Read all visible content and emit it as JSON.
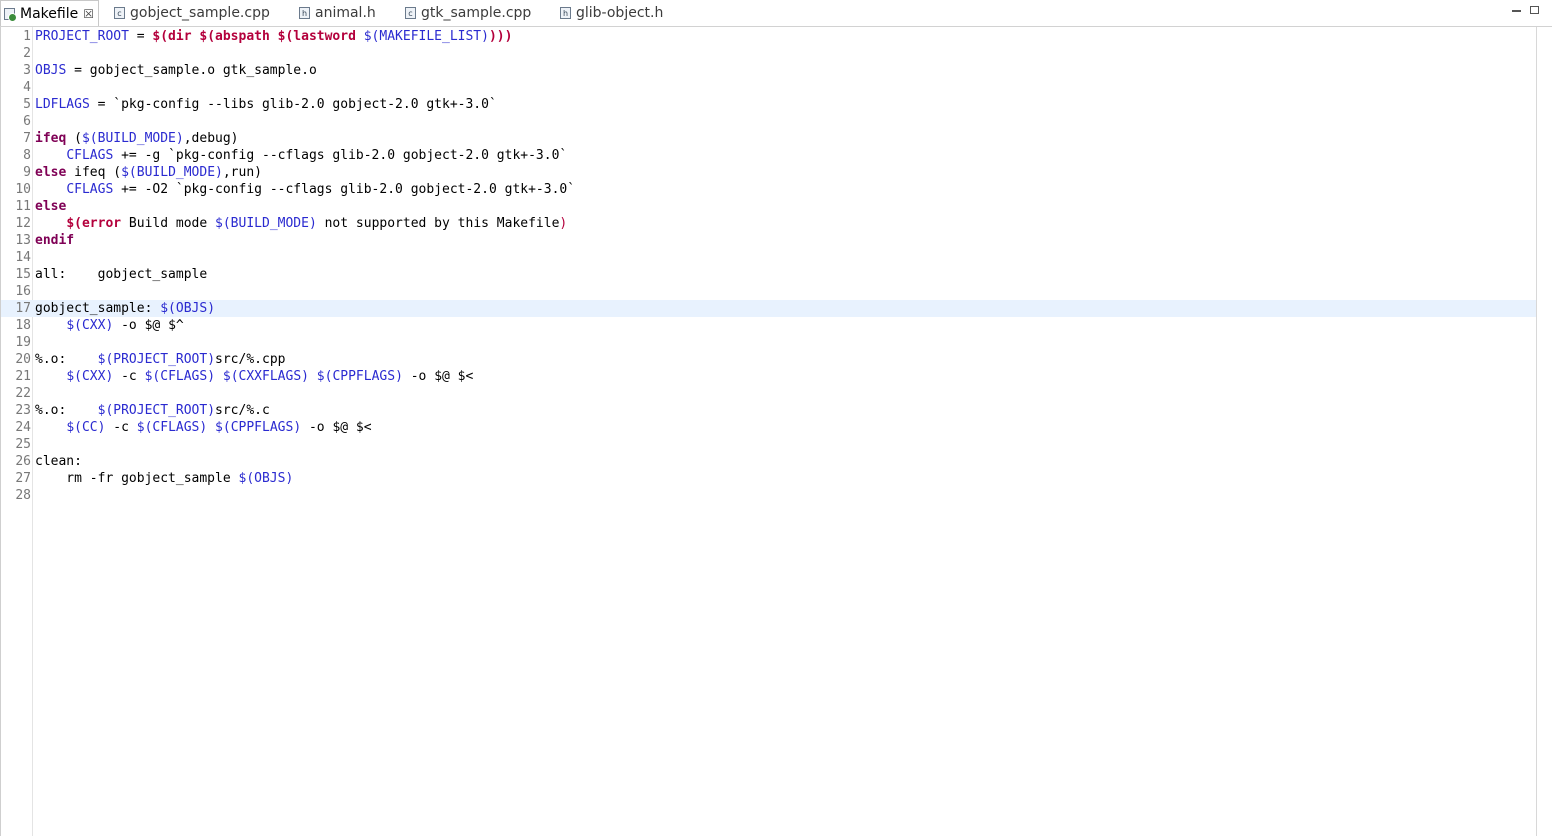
{
  "tabs": [
    {
      "label": "Makefile",
      "icon": "makefile-icon",
      "active": true
    },
    {
      "label": "gobject_sample.cpp",
      "icon": "cpp-file-icon"
    },
    {
      "label": "animal.h",
      "icon": "header-file-icon"
    },
    {
      "label": "gtk_sample.cpp",
      "icon": "cpp-file-icon"
    },
    {
      "label": "glib-object.h",
      "icon": "header-file-icon"
    }
  ],
  "close_glyph": "☒",
  "colors": {
    "variable": "#2a2ad0",
    "keyword": "#7f0055",
    "function": "#b4003c",
    "current_line": "#e8f2fe"
  },
  "current_line": 17,
  "lines": [
    {
      "n": "1",
      "segs": [
        [
          "v",
          "PROJECT_ROOT"
        ],
        [
          "p",
          " = "
        ],
        [
          "f",
          "$(dir $(abspath $(lastword "
        ],
        [
          "v",
          "$(MAKEFILE_LIST)"
        ],
        [
          "f",
          ")))"
        ]
      ]
    },
    {
      "n": "2",
      "segs": []
    },
    {
      "n": "3",
      "segs": [
        [
          "v",
          "OBJS"
        ],
        [
          "p",
          " = gobject_sample.o gtk_sample.o"
        ]
      ]
    },
    {
      "n": "4",
      "segs": []
    },
    {
      "n": "5",
      "segs": [
        [
          "v",
          "LDFLAGS"
        ],
        [
          "p",
          " = `pkg-config --libs glib-2.0 gobject-2.0 gtk+-3.0`"
        ]
      ]
    },
    {
      "n": "6",
      "segs": []
    },
    {
      "n": "7",
      "segs": [
        [
          "k",
          "ifeq"
        ],
        [
          "p",
          " ("
        ],
        [
          "v",
          "$(BUILD_MODE)"
        ],
        [
          "p",
          ",debug)"
        ]
      ]
    },
    {
      "n": "8",
      "segs": [
        [
          "p",
          "    "
        ],
        [
          "v",
          "CFLAGS"
        ],
        [
          "p",
          " += -g `pkg-config --cflags glib-2.0 gobject-2.0 gtk+-3.0`"
        ]
      ]
    },
    {
      "n": "9",
      "segs": [
        [
          "k",
          "else"
        ],
        [
          "p",
          " ifeq ("
        ],
        [
          "v",
          "$(BUILD_MODE)"
        ],
        [
          "p",
          ",run)"
        ]
      ]
    },
    {
      "n": "10",
      "segs": [
        [
          "p",
          "    "
        ],
        [
          "v",
          "CFLAGS"
        ],
        [
          "p",
          " += -O2 `pkg-config --cflags glib-2.0 gobject-2.0 gtk+-3.0`"
        ]
      ]
    },
    {
      "n": "11",
      "segs": [
        [
          "k",
          "else"
        ]
      ]
    },
    {
      "n": "12",
      "segs": [
        [
          "p",
          "    "
        ],
        [
          "f",
          "$(error"
        ],
        [
          "p",
          " Build mode "
        ],
        [
          "v",
          "$(BUILD_MODE)"
        ],
        [
          "p",
          " not supported by this Makefile"
        ],
        [
          "r",
          ")"
        ]
      ]
    },
    {
      "n": "13",
      "segs": [
        [
          "k",
          "endif"
        ]
      ]
    },
    {
      "n": "14",
      "segs": []
    },
    {
      "n": "15",
      "segs": [
        [
          "p",
          "all:    gobject_sample"
        ]
      ]
    },
    {
      "n": "16",
      "segs": []
    },
    {
      "n": "17",
      "segs": [
        [
          "p",
          "gobject_sample: "
        ],
        [
          "v",
          "$(OBJS)"
        ]
      ]
    },
    {
      "n": "18",
      "segs": [
        [
          "p",
          "    "
        ],
        [
          "v",
          "$(CXX)"
        ],
        [
          "p",
          " -o $@ $^"
        ]
      ]
    },
    {
      "n": "19",
      "segs": []
    },
    {
      "n": "20",
      "segs": [
        [
          "p",
          "%.o:    "
        ],
        [
          "v",
          "$(PROJECT_ROOT)"
        ],
        [
          "p",
          "src/%.cpp"
        ]
      ]
    },
    {
      "n": "21",
      "segs": [
        [
          "p",
          "    "
        ],
        [
          "v",
          "$(CXX)"
        ],
        [
          "p",
          " -c "
        ],
        [
          "v",
          "$(CFLAGS)"
        ],
        [
          "p",
          " "
        ],
        [
          "v",
          "$(CXXFLAGS)"
        ],
        [
          "p",
          " "
        ],
        [
          "v",
          "$(CPPFLAGS)"
        ],
        [
          "p",
          " -o $@ $<"
        ]
      ]
    },
    {
      "n": "22",
      "segs": []
    },
    {
      "n": "23",
      "segs": [
        [
          "p",
          "%.o:    "
        ],
        [
          "v",
          "$(PROJECT_ROOT)"
        ],
        [
          "p",
          "src/%.c"
        ]
      ]
    },
    {
      "n": "24",
      "segs": [
        [
          "p",
          "    "
        ],
        [
          "v",
          "$(CC)"
        ],
        [
          "p",
          " -c "
        ],
        [
          "v",
          "$(CFLAGS)"
        ],
        [
          "p",
          " "
        ],
        [
          "v",
          "$(CPPFLAGS)"
        ],
        [
          "p",
          " -o $@ $<"
        ]
      ]
    },
    {
      "n": "25",
      "segs": []
    },
    {
      "n": "26",
      "segs": [
        [
          "p",
          "clean:"
        ]
      ]
    },
    {
      "n": "27",
      "segs": [
        [
          "p",
          "    rm -fr gobject_sample "
        ],
        [
          "v",
          "$(OBJS)"
        ]
      ]
    },
    {
      "n": "28",
      "segs": []
    }
  ]
}
